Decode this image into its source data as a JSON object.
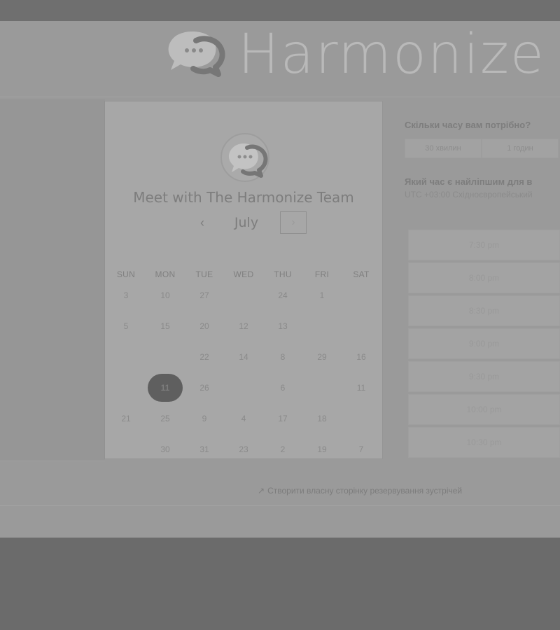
{
  "brand": {
    "name": "Harmonize",
    "logo_icon": "chat-bubble-icon"
  },
  "calendar": {
    "title": "Meet with The Harmonize Team",
    "month": "July",
    "prev_symbol": "‹",
    "next_symbol": "›",
    "weekdays": [
      "SUN",
      "MON",
      "TUE",
      "WED",
      "THU",
      "FRI",
      "SAT"
    ],
    "days": [
      [
        "3",
        "10",
        "27",
        "",
        "24",
        "1",
        ""
      ],
      [
        "5",
        "15",
        "20",
        "12",
        "13",
        "",
        ""
      ],
      [
        "",
        "",
        "22",
        "14",
        "8",
        "29",
        "16"
      ],
      [
        "",
        "11",
        "26",
        "",
        "6",
        "",
        "11"
      ],
      [
        "21",
        "25",
        "9",
        "4",
        "17",
        "18",
        ""
      ],
      [
        "",
        "30",
        "31",
        "23",
        "2",
        "19",
        "7"
      ]
    ],
    "selected_day": "11"
  },
  "duration": {
    "title": "Скільки часу вам потрібно?",
    "options": [
      "30 хвилин",
      "1 годин"
    ]
  },
  "times": {
    "title": "Який час є найліпшим для в",
    "timezone": "UTC +03:00 Східноєвропейський",
    "slots": [
      "7:30 pm",
      "8:00 pm",
      "8:30 pm",
      "9:00 pm",
      "9:30 pm",
      "10:00 pm",
      "10:30 pm"
    ]
  },
  "footer": {
    "create_page": "Створити власну сторінку резервування зустрічей"
  },
  "colors": {
    "overlay": "#6b6b6b",
    "page": "#9a9a9a",
    "card": "#a7a7a7",
    "selected_day": "#5f5f5f"
  }
}
